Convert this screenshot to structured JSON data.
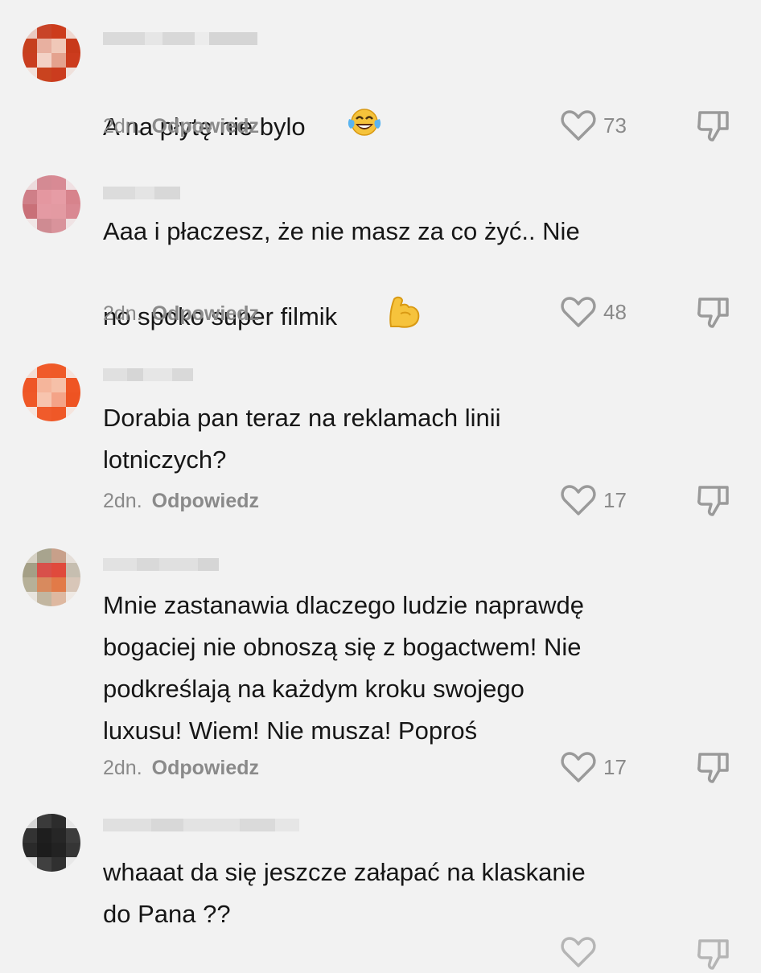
{
  "comments": [
    {
      "text": "A na płytę nie bylo",
      "emoji": "face-with-tears-of-joy",
      "time": "2dn.",
      "reply_label": "Odpowiedz",
      "likes": "73"
    },
    {
      "text": "Aaa i płaczesz, że nie masz za co żyć.. Nie\nno spoko super filmik ",
      "emoji": "flexed-biceps",
      "time": "2dn.",
      "reply_label": "Odpowiedz",
      "likes": "48"
    },
    {
      "text": "Dorabia pan teraz na reklamach linii\nlotniczych?",
      "time": "2dn.",
      "reply_label": "Odpowiedz",
      "likes": "17"
    },
    {
      "text": "Mnie zastanawia dlaczego ludzie naprawdę\nbogaciej nie obnoszą się z bogactwem! Nie\npodkreślają na każdym kroku swojego\nluxusu! Wiem! Nie musza! Poproś",
      "time": "2dn.",
      "reply_label": "Odpowiedz",
      "likes": "17"
    },
    {
      "text": "whaaat da się jeszcze załapać na klaskanie\ndo Pana ??"
    }
  ],
  "colors": {
    "background": "#f2f2f2",
    "meta_text": "#8a8a8a",
    "icon_stroke": "#9a9a9a"
  }
}
